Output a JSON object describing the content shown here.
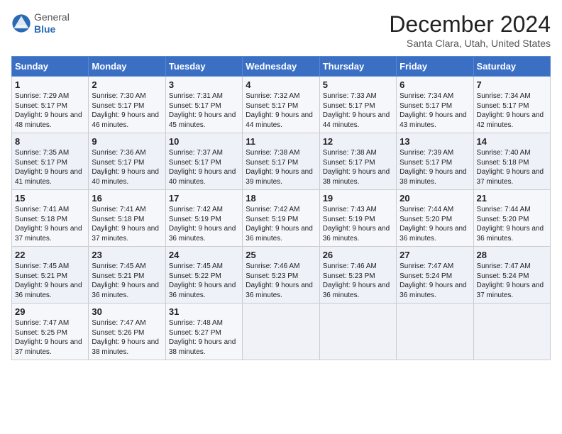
{
  "logo": {
    "general": "General",
    "blue": "Blue"
  },
  "title": "December 2024",
  "location": "Santa Clara, Utah, United States",
  "days_of_week": [
    "Sunday",
    "Monday",
    "Tuesday",
    "Wednesday",
    "Thursday",
    "Friday",
    "Saturday"
  ],
  "weeks": [
    [
      {
        "num": "1",
        "sunrise": "7:29 AM",
        "sunset": "5:17 PM",
        "daylight": "9 hours and 48 minutes."
      },
      {
        "num": "2",
        "sunrise": "7:30 AM",
        "sunset": "5:17 PM",
        "daylight": "9 hours and 46 minutes."
      },
      {
        "num": "3",
        "sunrise": "7:31 AM",
        "sunset": "5:17 PM",
        "daylight": "9 hours and 45 minutes."
      },
      {
        "num": "4",
        "sunrise": "7:32 AM",
        "sunset": "5:17 PM",
        "daylight": "9 hours and 44 minutes."
      },
      {
        "num": "5",
        "sunrise": "7:33 AM",
        "sunset": "5:17 PM",
        "daylight": "9 hours and 44 minutes."
      },
      {
        "num": "6",
        "sunrise": "7:34 AM",
        "sunset": "5:17 PM",
        "daylight": "9 hours and 43 minutes."
      },
      {
        "num": "7",
        "sunrise": "7:34 AM",
        "sunset": "5:17 PM",
        "daylight": "9 hours and 42 minutes."
      }
    ],
    [
      {
        "num": "8",
        "sunrise": "7:35 AM",
        "sunset": "5:17 PM",
        "daylight": "9 hours and 41 minutes."
      },
      {
        "num": "9",
        "sunrise": "7:36 AM",
        "sunset": "5:17 PM",
        "daylight": "9 hours and 40 minutes."
      },
      {
        "num": "10",
        "sunrise": "7:37 AM",
        "sunset": "5:17 PM",
        "daylight": "9 hours and 40 minutes."
      },
      {
        "num": "11",
        "sunrise": "7:38 AM",
        "sunset": "5:17 PM",
        "daylight": "9 hours and 39 minutes."
      },
      {
        "num": "12",
        "sunrise": "7:38 AM",
        "sunset": "5:17 PM",
        "daylight": "9 hours and 38 minutes."
      },
      {
        "num": "13",
        "sunrise": "7:39 AM",
        "sunset": "5:17 PM",
        "daylight": "9 hours and 38 minutes."
      },
      {
        "num": "14",
        "sunrise": "7:40 AM",
        "sunset": "5:18 PM",
        "daylight": "9 hours and 37 minutes."
      }
    ],
    [
      {
        "num": "15",
        "sunrise": "7:41 AM",
        "sunset": "5:18 PM",
        "daylight": "9 hours and 37 minutes."
      },
      {
        "num": "16",
        "sunrise": "7:41 AM",
        "sunset": "5:18 PM",
        "daylight": "9 hours and 37 minutes."
      },
      {
        "num": "17",
        "sunrise": "7:42 AM",
        "sunset": "5:19 PM",
        "daylight": "9 hours and 36 minutes."
      },
      {
        "num": "18",
        "sunrise": "7:42 AM",
        "sunset": "5:19 PM",
        "daylight": "9 hours and 36 minutes."
      },
      {
        "num": "19",
        "sunrise": "7:43 AM",
        "sunset": "5:19 PM",
        "daylight": "9 hours and 36 minutes."
      },
      {
        "num": "20",
        "sunrise": "7:44 AM",
        "sunset": "5:20 PM",
        "daylight": "9 hours and 36 minutes."
      },
      {
        "num": "21",
        "sunrise": "7:44 AM",
        "sunset": "5:20 PM",
        "daylight": "9 hours and 36 minutes."
      }
    ],
    [
      {
        "num": "22",
        "sunrise": "7:45 AM",
        "sunset": "5:21 PM",
        "daylight": "9 hours and 36 minutes."
      },
      {
        "num": "23",
        "sunrise": "7:45 AM",
        "sunset": "5:21 PM",
        "daylight": "9 hours and 36 minutes."
      },
      {
        "num": "24",
        "sunrise": "7:45 AM",
        "sunset": "5:22 PM",
        "daylight": "9 hours and 36 minutes."
      },
      {
        "num": "25",
        "sunrise": "7:46 AM",
        "sunset": "5:23 PM",
        "daylight": "9 hours and 36 minutes."
      },
      {
        "num": "26",
        "sunrise": "7:46 AM",
        "sunset": "5:23 PM",
        "daylight": "9 hours and 36 minutes."
      },
      {
        "num": "27",
        "sunrise": "7:47 AM",
        "sunset": "5:24 PM",
        "daylight": "9 hours and 36 minutes."
      },
      {
        "num": "28",
        "sunrise": "7:47 AM",
        "sunset": "5:24 PM",
        "daylight": "9 hours and 37 minutes."
      }
    ],
    [
      {
        "num": "29",
        "sunrise": "7:47 AM",
        "sunset": "5:25 PM",
        "daylight": "9 hours and 37 minutes."
      },
      {
        "num": "30",
        "sunrise": "7:47 AM",
        "sunset": "5:26 PM",
        "daylight": "9 hours and 38 minutes."
      },
      {
        "num": "31",
        "sunrise": "7:48 AM",
        "sunset": "5:27 PM",
        "daylight": "9 hours and 38 minutes."
      },
      null,
      null,
      null,
      null
    ]
  ]
}
